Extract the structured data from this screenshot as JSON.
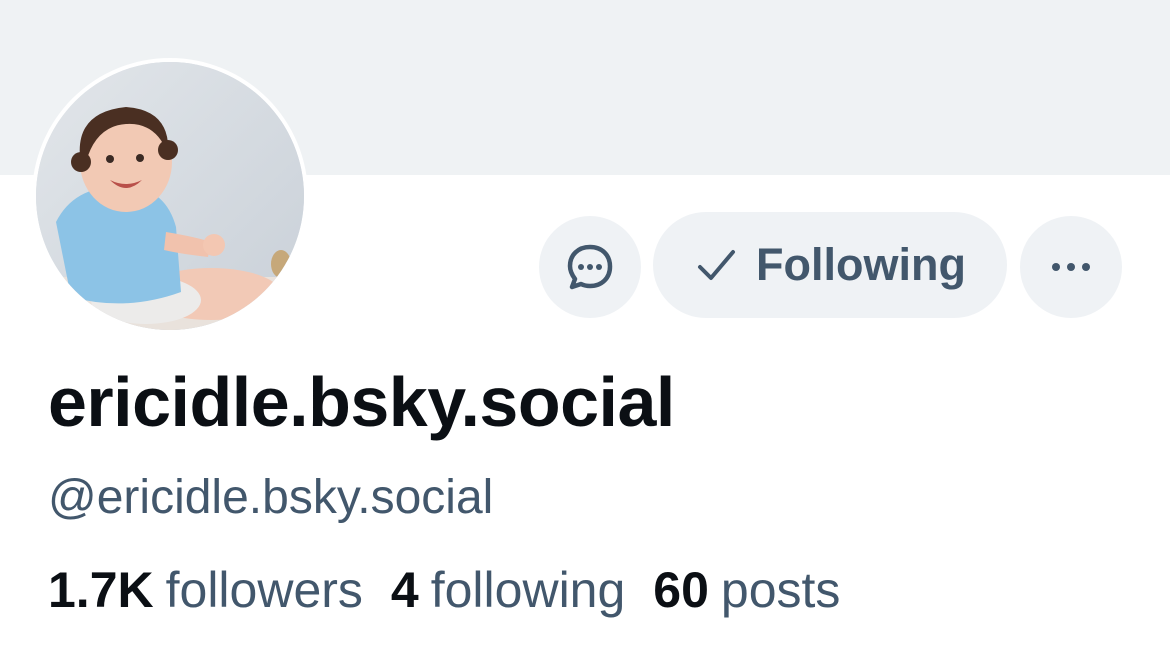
{
  "profile": {
    "display_name": "ericidle.bsky.social",
    "handle": "@ericidle.bsky.social",
    "avatar_icon": "baby-photo-avatar"
  },
  "actions": {
    "message_icon": "message-bubble-icon",
    "follow_label": "Following",
    "follow_icon": "check-icon",
    "more_icon": "ellipsis-icon"
  },
  "stats": {
    "followers_count": "1.7K",
    "followers_label": "followers",
    "following_count": "4",
    "following_label": "following",
    "posts_count": "60",
    "posts_label": "posts"
  },
  "colors": {
    "banner": "#eff2f4",
    "button_bg": "#eff2f5",
    "secondary_text": "#42576c",
    "primary_text": "#0b0f14"
  }
}
